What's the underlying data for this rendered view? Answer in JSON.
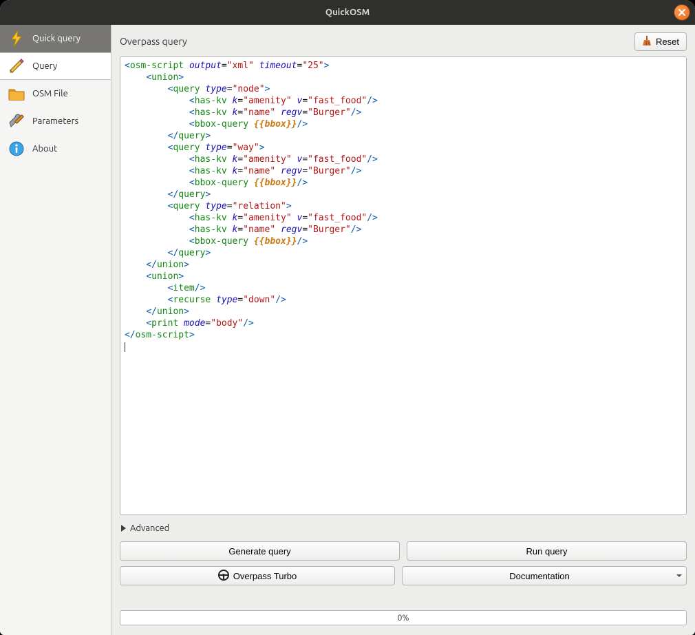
{
  "window": {
    "title": "QuickOSM"
  },
  "sidebar": {
    "items": [
      {
        "label": "Quick query",
        "icon": "lightning-icon"
      },
      {
        "label": "Query",
        "icon": "pencil-icon"
      },
      {
        "label": "OSM File",
        "icon": "folder-icon"
      },
      {
        "label": "Parameters",
        "icon": "tools-icon"
      },
      {
        "label": "About",
        "icon": "info-icon"
      }
    ],
    "active_index": 0,
    "selected_index": 1
  },
  "section": {
    "title": "Overpass query",
    "reset_label": "Reset"
  },
  "query_code": [
    [
      [
        "br",
        "<"
      ],
      [
        "tag",
        "osm-script"
      ],
      [
        "sp",
        " "
      ],
      [
        "attr",
        "output"
      ],
      [
        "eq",
        "="
      ],
      [
        "val",
        "\"xml\""
      ],
      [
        "sp",
        " "
      ],
      [
        "attr",
        "timeout"
      ],
      [
        "eq",
        "="
      ],
      [
        "val",
        "\"25\""
      ],
      [
        "br",
        ">"
      ]
    ],
    [
      [
        "ind",
        2
      ],
      [
        "br",
        "<"
      ],
      [
        "tag",
        "union"
      ],
      [
        "br",
        ">"
      ]
    ],
    [
      [
        "ind",
        4
      ],
      [
        "br",
        "<"
      ],
      [
        "tag",
        "query"
      ],
      [
        "sp",
        " "
      ],
      [
        "attr",
        "type"
      ],
      [
        "eq",
        "="
      ],
      [
        "val",
        "\"node\""
      ],
      [
        "br",
        ">"
      ]
    ],
    [
      [
        "ind",
        6
      ],
      [
        "br",
        "<"
      ],
      [
        "tag",
        "has-kv"
      ],
      [
        "sp",
        " "
      ],
      [
        "attr",
        "k"
      ],
      [
        "eq",
        "="
      ],
      [
        "val",
        "\"amenity\""
      ],
      [
        "sp",
        " "
      ],
      [
        "attr",
        "v"
      ],
      [
        "eq",
        "="
      ],
      [
        "val",
        "\"fast_food\""
      ],
      [
        "br",
        "/>"
      ]
    ],
    [
      [
        "ind",
        6
      ],
      [
        "br",
        "<"
      ],
      [
        "tag",
        "has-kv"
      ],
      [
        "sp",
        " "
      ],
      [
        "attr",
        "k"
      ],
      [
        "eq",
        "="
      ],
      [
        "val",
        "\"name\""
      ],
      [
        "sp",
        " "
      ],
      [
        "attr",
        "regv"
      ],
      [
        "eq",
        "="
      ],
      [
        "val",
        "\"Burger\""
      ],
      [
        "br",
        "/>"
      ]
    ],
    [
      [
        "ind",
        6
      ],
      [
        "br",
        "<"
      ],
      [
        "tag",
        "bbox-query"
      ],
      [
        "sp",
        " "
      ],
      [
        "tmpl",
        "{{bbox}}"
      ],
      [
        "br",
        "/>"
      ]
    ],
    [
      [
        "ind",
        4
      ],
      [
        "br",
        "</"
      ],
      [
        "tag",
        "query"
      ],
      [
        "br",
        ">"
      ]
    ],
    [
      [
        "ind",
        4
      ],
      [
        "br",
        "<"
      ],
      [
        "tag",
        "query"
      ],
      [
        "sp",
        " "
      ],
      [
        "attr",
        "type"
      ],
      [
        "eq",
        "="
      ],
      [
        "val",
        "\"way\""
      ],
      [
        "br",
        ">"
      ]
    ],
    [
      [
        "ind",
        6
      ],
      [
        "br",
        "<"
      ],
      [
        "tag",
        "has-kv"
      ],
      [
        "sp",
        " "
      ],
      [
        "attr",
        "k"
      ],
      [
        "eq",
        "="
      ],
      [
        "val",
        "\"amenity\""
      ],
      [
        "sp",
        " "
      ],
      [
        "attr",
        "v"
      ],
      [
        "eq",
        "="
      ],
      [
        "val",
        "\"fast_food\""
      ],
      [
        "br",
        "/>"
      ]
    ],
    [
      [
        "ind",
        6
      ],
      [
        "br",
        "<"
      ],
      [
        "tag",
        "has-kv"
      ],
      [
        "sp",
        " "
      ],
      [
        "attr",
        "k"
      ],
      [
        "eq",
        "="
      ],
      [
        "val",
        "\"name\""
      ],
      [
        "sp",
        " "
      ],
      [
        "attr",
        "regv"
      ],
      [
        "eq",
        "="
      ],
      [
        "val",
        "\"Burger\""
      ],
      [
        "br",
        "/>"
      ]
    ],
    [
      [
        "ind",
        6
      ],
      [
        "br",
        "<"
      ],
      [
        "tag",
        "bbox-query"
      ],
      [
        "sp",
        " "
      ],
      [
        "tmpl",
        "{{bbox}}"
      ],
      [
        "br",
        "/>"
      ]
    ],
    [
      [
        "ind",
        4
      ],
      [
        "br",
        "</"
      ],
      [
        "tag",
        "query"
      ],
      [
        "br",
        ">"
      ]
    ],
    [
      [
        "ind",
        4
      ],
      [
        "br",
        "<"
      ],
      [
        "tag",
        "query"
      ],
      [
        "sp",
        " "
      ],
      [
        "attr",
        "type"
      ],
      [
        "eq",
        "="
      ],
      [
        "val",
        "\"relation\""
      ],
      [
        "br",
        ">"
      ]
    ],
    [
      [
        "ind",
        6
      ],
      [
        "br",
        "<"
      ],
      [
        "tag",
        "has-kv"
      ],
      [
        "sp",
        " "
      ],
      [
        "attr",
        "k"
      ],
      [
        "eq",
        "="
      ],
      [
        "val",
        "\"amenity\""
      ],
      [
        "sp",
        " "
      ],
      [
        "attr",
        "v"
      ],
      [
        "eq",
        "="
      ],
      [
        "val",
        "\"fast_food\""
      ],
      [
        "br",
        "/>"
      ]
    ],
    [
      [
        "ind",
        6
      ],
      [
        "br",
        "<"
      ],
      [
        "tag",
        "has-kv"
      ],
      [
        "sp",
        " "
      ],
      [
        "attr",
        "k"
      ],
      [
        "eq",
        "="
      ],
      [
        "val",
        "\"name\""
      ],
      [
        "sp",
        " "
      ],
      [
        "attr",
        "regv"
      ],
      [
        "eq",
        "="
      ],
      [
        "val",
        "\"Burger\""
      ],
      [
        "br",
        "/>"
      ]
    ],
    [
      [
        "ind",
        6
      ],
      [
        "br",
        "<"
      ],
      [
        "tag",
        "bbox-query"
      ],
      [
        "sp",
        " "
      ],
      [
        "tmpl",
        "{{bbox}}"
      ],
      [
        "br",
        "/>"
      ]
    ],
    [
      [
        "ind",
        4
      ],
      [
        "br",
        "</"
      ],
      [
        "tag",
        "query"
      ],
      [
        "br",
        ">"
      ]
    ],
    [
      [
        "ind",
        2
      ],
      [
        "br",
        "</"
      ],
      [
        "tag",
        "union"
      ],
      [
        "br",
        ">"
      ]
    ],
    [
      [
        "ind",
        2
      ],
      [
        "br",
        "<"
      ],
      [
        "tag",
        "union"
      ],
      [
        "br",
        ">"
      ]
    ],
    [
      [
        "ind",
        4
      ],
      [
        "br",
        "<"
      ],
      [
        "tag",
        "item"
      ],
      [
        "br",
        "/>"
      ]
    ],
    [
      [
        "ind",
        4
      ],
      [
        "br",
        "<"
      ],
      [
        "tag",
        "recurse"
      ],
      [
        "sp",
        " "
      ],
      [
        "attr",
        "type"
      ],
      [
        "eq",
        "="
      ],
      [
        "val",
        "\"down\""
      ],
      [
        "br",
        "/>"
      ]
    ],
    [
      [
        "ind",
        2
      ],
      [
        "br",
        "</"
      ],
      [
        "tag",
        "union"
      ],
      [
        "br",
        ">"
      ]
    ],
    [
      [
        "ind",
        2
      ],
      [
        "br",
        "<"
      ],
      [
        "tag",
        "print"
      ],
      [
        "sp",
        " "
      ],
      [
        "attr",
        "mode"
      ],
      [
        "eq",
        "="
      ],
      [
        "val",
        "\"body\""
      ],
      [
        "br",
        "/>"
      ]
    ],
    [
      [
        "br",
        "</"
      ],
      [
        "tag",
        "osm-script"
      ],
      [
        "br",
        ">"
      ]
    ]
  ],
  "advanced": {
    "label": "Advanced",
    "expanded": false
  },
  "buttons": {
    "generate": "Generate query",
    "run": "Run query",
    "turbo": "Overpass Turbo",
    "docs": "Documentation"
  },
  "progress": {
    "text": "0%"
  }
}
